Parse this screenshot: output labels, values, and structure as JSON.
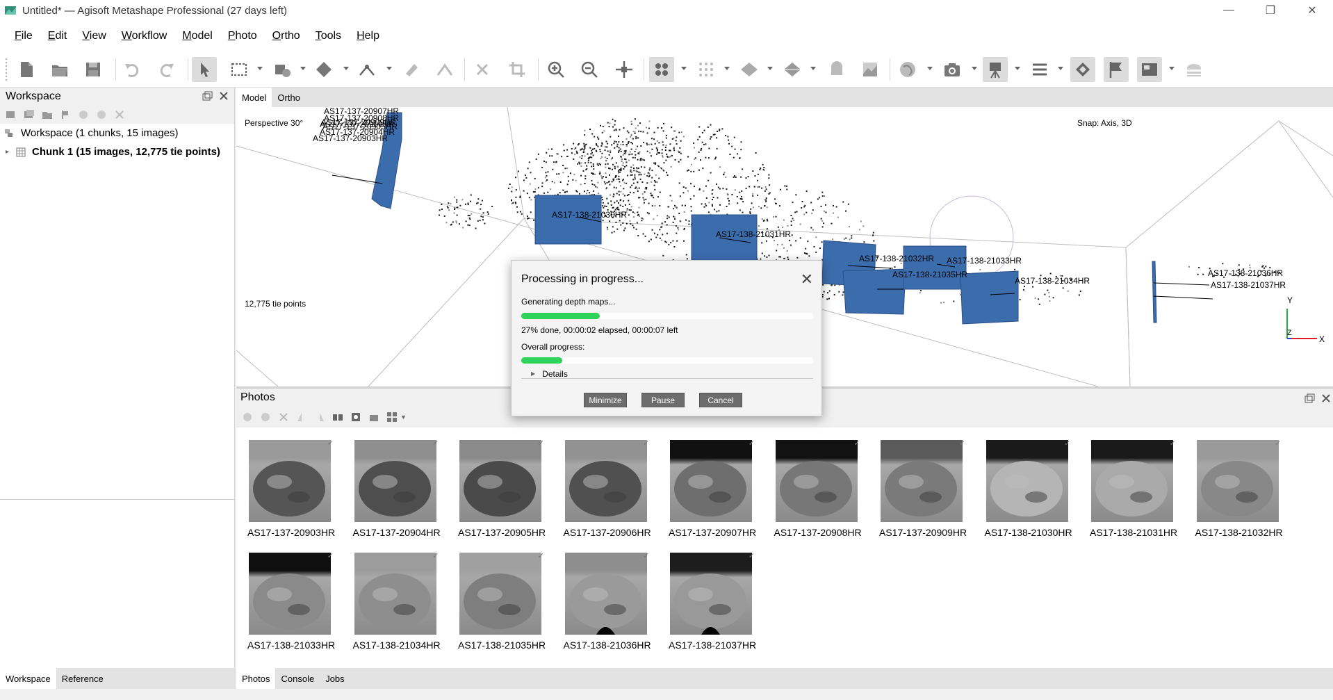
{
  "window": {
    "title": "Untitled* — Agisoft Metashape Professional (27 days left)",
    "minimize_glyph": "—",
    "maximize_glyph": "❐",
    "close_glyph": "✕"
  },
  "menu": [
    "File",
    "Edit",
    "View",
    "Workflow",
    "Model",
    "Photo",
    "Ortho",
    "Tools",
    "Help"
  ],
  "workspace": {
    "header": "Workspace",
    "root_label": "Workspace (1 chunks, 15 images)",
    "chunk_label": "Chunk 1 (15 images, 12,775 tie points)",
    "tabs": [
      "Workspace",
      "Reference"
    ]
  },
  "view": {
    "tabs": [
      "Model",
      "Ortho"
    ],
    "perspective": "Perspective 30°",
    "snap": "Snap: Axis, 3D",
    "tie_points": "12,775 tie points",
    "axes": {
      "x": "X",
      "y": "Y",
      "z": "Z"
    },
    "camera_labels": [
      "AS17-137-20907HR",
      "AS17-137-20908HR",
      "AS17-137-20909HR",
      "AS17-137-20906HR",
      "AS17-137-20905HR",
      "AS17-137-20904HR",
      "AS17-137-20903HR",
      "AS17-138-21030HR",
      "AS17-138-21031HR",
      "AS17-138-21032HR",
      "AS17-138-21033HR",
      "AS17-138-21035HR",
      "AS17-138-21034HR",
      "AS17-138-21036HR",
      "AS17-138-21037HR"
    ]
  },
  "photos": {
    "header": "Photos",
    "items": [
      "AS17-137-20903HR",
      "AS17-137-20904HR",
      "AS17-137-20905HR",
      "AS17-137-20906HR",
      "AS17-137-20907HR",
      "AS17-137-20908HR",
      "AS17-137-20909HR",
      "AS17-138-21030HR",
      "AS17-138-21031HR",
      "AS17-138-21032HR",
      "AS17-138-21033HR",
      "AS17-138-21034HR",
      "AS17-138-21035HR",
      "AS17-138-21036HR",
      "AS17-138-21037HR"
    ],
    "tabs": [
      "Photos",
      "Console",
      "Jobs"
    ]
  },
  "dialog": {
    "title": "Processing in progress...",
    "close_glyph": "✕",
    "stage": "Generating depth maps...",
    "stage_progress": 0.27,
    "stage_status": "27% done, 00:00:02 elapsed, 00:00:07 left",
    "overall_label": "Overall progress:",
    "overall_progress": 0.14,
    "details": "Details",
    "buttons": {
      "minimize": "Minimize",
      "pause": "Pause",
      "cancel": "Cancel"
    }
  },
  "colors": {
    "camera_blue": "#3b6dad",
    "progress_green": "#2ed35a",
    "button_gray": "#6d6d6d"
  },
  "icons": [
    "new-icon",
    "open-icon",
    "save-icon",
    "undo-icon",
    "redo-icon",
    "navigation-icon",
    "rect-select-icon",
    "move-object-icon",
    "rotate-object-icon",
    "ruler-icon",
    "shape-icon",
    "delete-icon",
    "crop-icon",
    "zoom-in-icon",
    "zoom-out-icon",
    "reset-view-icon",
    "point-cloud-icon",
    "dense-cloud-icon",
    "mesh-icon",
    "model-icon",
    "tiled-icon",
    "dem-icon",
    "globe-icon",
    "camera-icon",
    "camera-rig-icon",
    "menu-icon",
    "shape-tool-icon",
    "flag-icon",
    "image-icon",
    "stack-icon"
  ]
}
